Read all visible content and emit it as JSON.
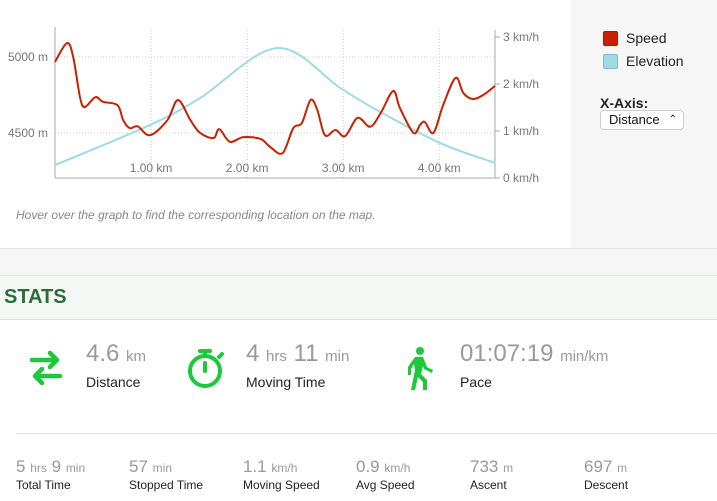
{
  "chart_data": {
    "type": "line",
    "xlabel": "",
    "x_tick_labels": [
      "1.00 km",
      "2.00 km",
      "3.00 km",
      "4.00 km"
    ],
    "xlim": [
      0,
      4.58
    ],
    "left_axis": {
      "ticks": [
        4500,
        5000
      ],
      "tick_labels": [
        "4500 m",
        "5000 m"
      ],
      "ylim": [
        4204,
        5178
      ]
    },
    "right_axis": {
      "ticks": [
        0,
        1,
        2,
        3
      ],
      "tick_labels": [
        "0 km/h",
        "1 km/h",
        "2 km/h",
        "3 km/h"
      ],
      "ylim": [
        0,
        3
      ]
    },
    "grid": true,
    "legend": "right",
    "series": [
      {
        "name": "Speed",
        "color": "#c82000",
        "axis": "right",
        "x": [
          0,
          0.125,
          0.19,
          0.26,
          0.31,
          0.42,
          0.5,
          0.65,
          0.71,
          0.78,
          0.86,
          0.99,
          1.17,
          1.28,
          1.41,
          1.51,
          1.65,
          1.71,
          1.82,
          1.96,
          2.14,
          2.24,
          2.37,
          2.48,
          2.57,
          2.66,
          2.73,
          2.81,
          2.92,
          3.02,
          3.15,
          3.28,
          3.39,
          3.52,
          3.59,
          3.73,
          3.8,
          3.85,
          3.94,
          4.04,
          4.17,
          4.25,
          4.35,
          4.46,
          4.58
        ],
        "y": [
          2.47,
          2.87,
          2.57,
          1.72,
          1.51,
          1.72,
          1.62,
          1.55,
          1.23,
          1.06,
          1.1,
          0.91,
          1.23,
          1.66,
          1.23,
          0.96,
          0.85,
          1.04,
          0.77,
          0.87,
          0.83,
          0.66,
          0.53,
          1.06,
          1.17,
          1.66,
          1.45,
          0.91,
          1.02,
          0.89,
          1.28,
          1.09,
          1.38,
          1.85,
          1.49,
          0.96,
          1.13,
          1.19,
          0.96,
          1.55,
          2.13,
          1.81,
          1.68,
          1.77,
          1.96
        ]
      },
      {
        "name": "Elevation",
        "color": "#9ddbe6",
        "axis": "left",
        "x": [
          0,
          0.99,
          1.51,
          2.31,
          2.97,
          3.35,
          4.01,
          4.58
        ],
        "y": [
          4289,
          4553,
          4730,
          5059,
          4796,
          4651,
          4434,
          4303
        ]
      }
    ]
  },
  "legend": {
    "items": [
      {
        "label": "Speed",
        "color": "#c82000"
      },
      {
        "label": "Elevation",
        "color": "#9ddbe6"
      }
    ]
  },
  "xaxis_control": {
    "label": "X-Axis:",
    "selected": "Distance"
  },
  "hint": "Hover over the graph to find the corresponding location on the map.",
  "stats": {
    "title": "STATS",
    "accent": "#1ec83c",
    "main": [
      {
        "icon": "swap-arrows-icon",
        "value": "4.6",
        "unit": "km",
        "label": "Distance"
      },
      {
        "icon": "stopwatch-icon",
        "value": "4",
        "unit": "hrs",
        "value2": "11",
        "unit2": "min",
        "label": "Moving Time"
      },
      {
        "icon": "walking-person-icon",
        "value": "01:07:19",
        "unit": "min/km",
        "label": "Pace"
      }
    ],
    "secondary": [
      {
        "value": "5",
        "unit": "hrs",
        "value2": "9",
        "unit2": "min",
        "label": "Total Time"
      },
      {
        "value": "57",
        "unit": "min",
        "label": "Stopped Time"
      },
      {
        "value": "1.1",
        "unit": "km/h",
        "label": "Moving Speed"
      },
      {
        "value": "0.9",
        "unit": "km/h",
        "label": "Avg Speed"
      },
      {
        "value": "733",
        "unit": "m",
        "label": "Ascent"
      },
      {
        "value": "697",
        "unit": "m",
        "label": "Descent"
      }
    ]
  }
}
